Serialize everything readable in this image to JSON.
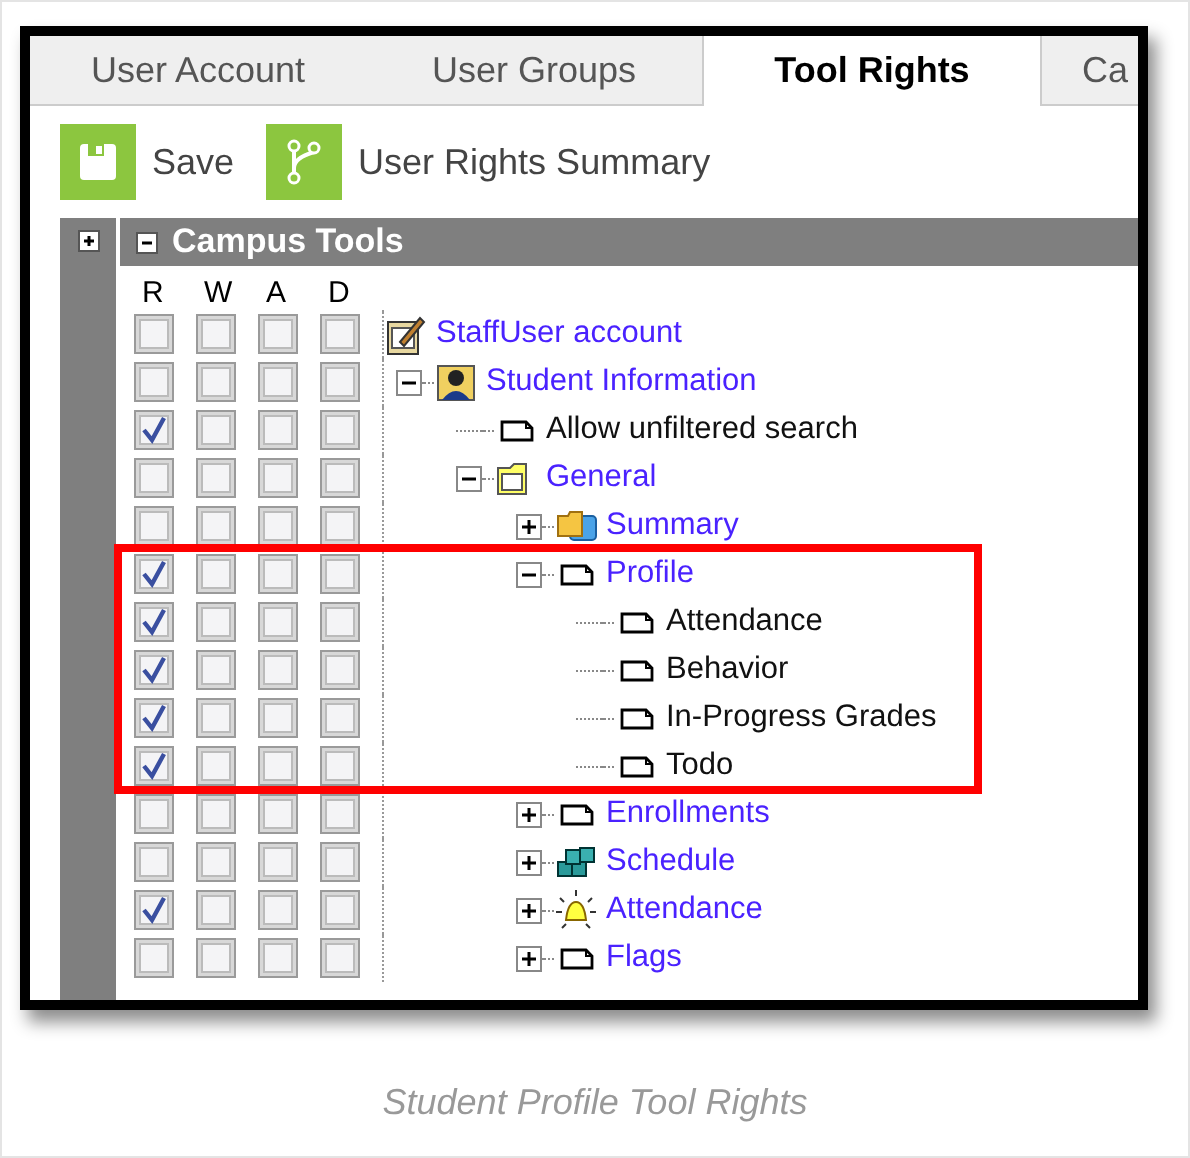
{
  "tabs": [
    {
      "label": "User Account",
      "selected": false
    },
    {
      "label": "User Groups",
      "selected": false
    },
    {
      "label": "Tool Rights",
      "selected": true
    },
    {
      "label": "Ca",
      "selected": false
    }
  ],
  "toolbar": [
    {
      "label": "Save",
      "kind": "save"
    },
    {
      "label": "User Rights Summary",
      "kind": "summary"
    }
  ],
  "panel": {
    "title": "Campus Tools",
    "columns": [
      "R",
      "W",
      "A",
      "D"
    ]
  },
  "tree": [
    {
      "label": "StaffUser account",
      "kind": "edit",
      "link": true,
      "rights": [
        false,
        false,
        false,
        false
      ],
      "children": [
        {
          "label": "Student Information",
          "kind": "person",
          "link": true,
          "expanded": true,
          "rights": [
            false,
            false,
            false,
            false
          ],
          "children": [
            {
              "label": "Allow unfiltered search",
              "kind": "page",
              "link": false,
              "rights": [
                true,
                false,
                false,
                false
              ]
            },
            {
              "label": "General",
              "kind": "folder",
              "link": true,
              "expanded": true,
              "rights": [
                false,
                false,
                false,
                false
              ],
              "children": [
                {
                  "label": "Summary",
                  "kind": "folders",
                  "link": true,
                  "expanded": false,
                  "rights": [
                    false,
                    false,
                    false,
                    false
                  ]
                },
                {
                  "label": "Profile",
                  "kind": "page",
                  "link": true,
                  "expanded": true,
                  "highlighted": true,
                  "rights": [
                    true,
                    false,
                    false,
                    false
                  ],
                  "children": [
                    {
                      "label": "Attendance",
                      "kind": "page",
                      "link": false,
                      "highlighted": true,
                      "rights": [
                        true,
                        false,
                        false,
                        false
                      ]
                    },
                    {
                      "label": "Behavior",
                      "kind": "page",
                      "link": false,
                      "highlighted": true,
                      "rights": [
                        true,
                        false,
                        false,
                        false
                      ]
                    },
                    {
                      "label": "In-Progress Grades",
                      "kind": "page",
                      "link": false,
                      "highlighted": true,
                      "rights": [
                        true,
                        false,
                        false,
                        false
                      ]
                    },
                    {
                      "label": "Todo",
                      "kind": "page",
                      "link": false,
                      "highlighted": true,
                      "rights": [
                        true,
                        false,
                        false,
                        false
                      ]
                    }
                  ]
                },
                {
                  "label": "Enrollments",
                  "kind": "page",
                  "link": true,
                  "expanded": false,
                  "rights": [
                    false,
                    false,
                    false,
                    false
                  ]
                },
                {
                  "label": "Schedule",
                  "kind": "blocks",
                  "link": true,
                  "expanded": false,
                  "rights": [
                    false,
                    false,
                    false,
                    false
                  ]
                },
                {
                  "label": "Attendance",
                  "kind": "bell",
                  "link": true,
                  "expanded": false,
                  "rights": [
                    true,
                    false,
                    false,
                    false
                  ]
                },
                {
                  "label": "Flags",
                  "kind": "page",
                  "link": true,
                  "expanded": false,
                  "rights": [
                    false,
                    false,
                    false,
                    false
                  ]
                }
              ]
            }
          ]
        }
      ]
    }
  ],
  "caption": "Student Profile Tool Rights"
}
